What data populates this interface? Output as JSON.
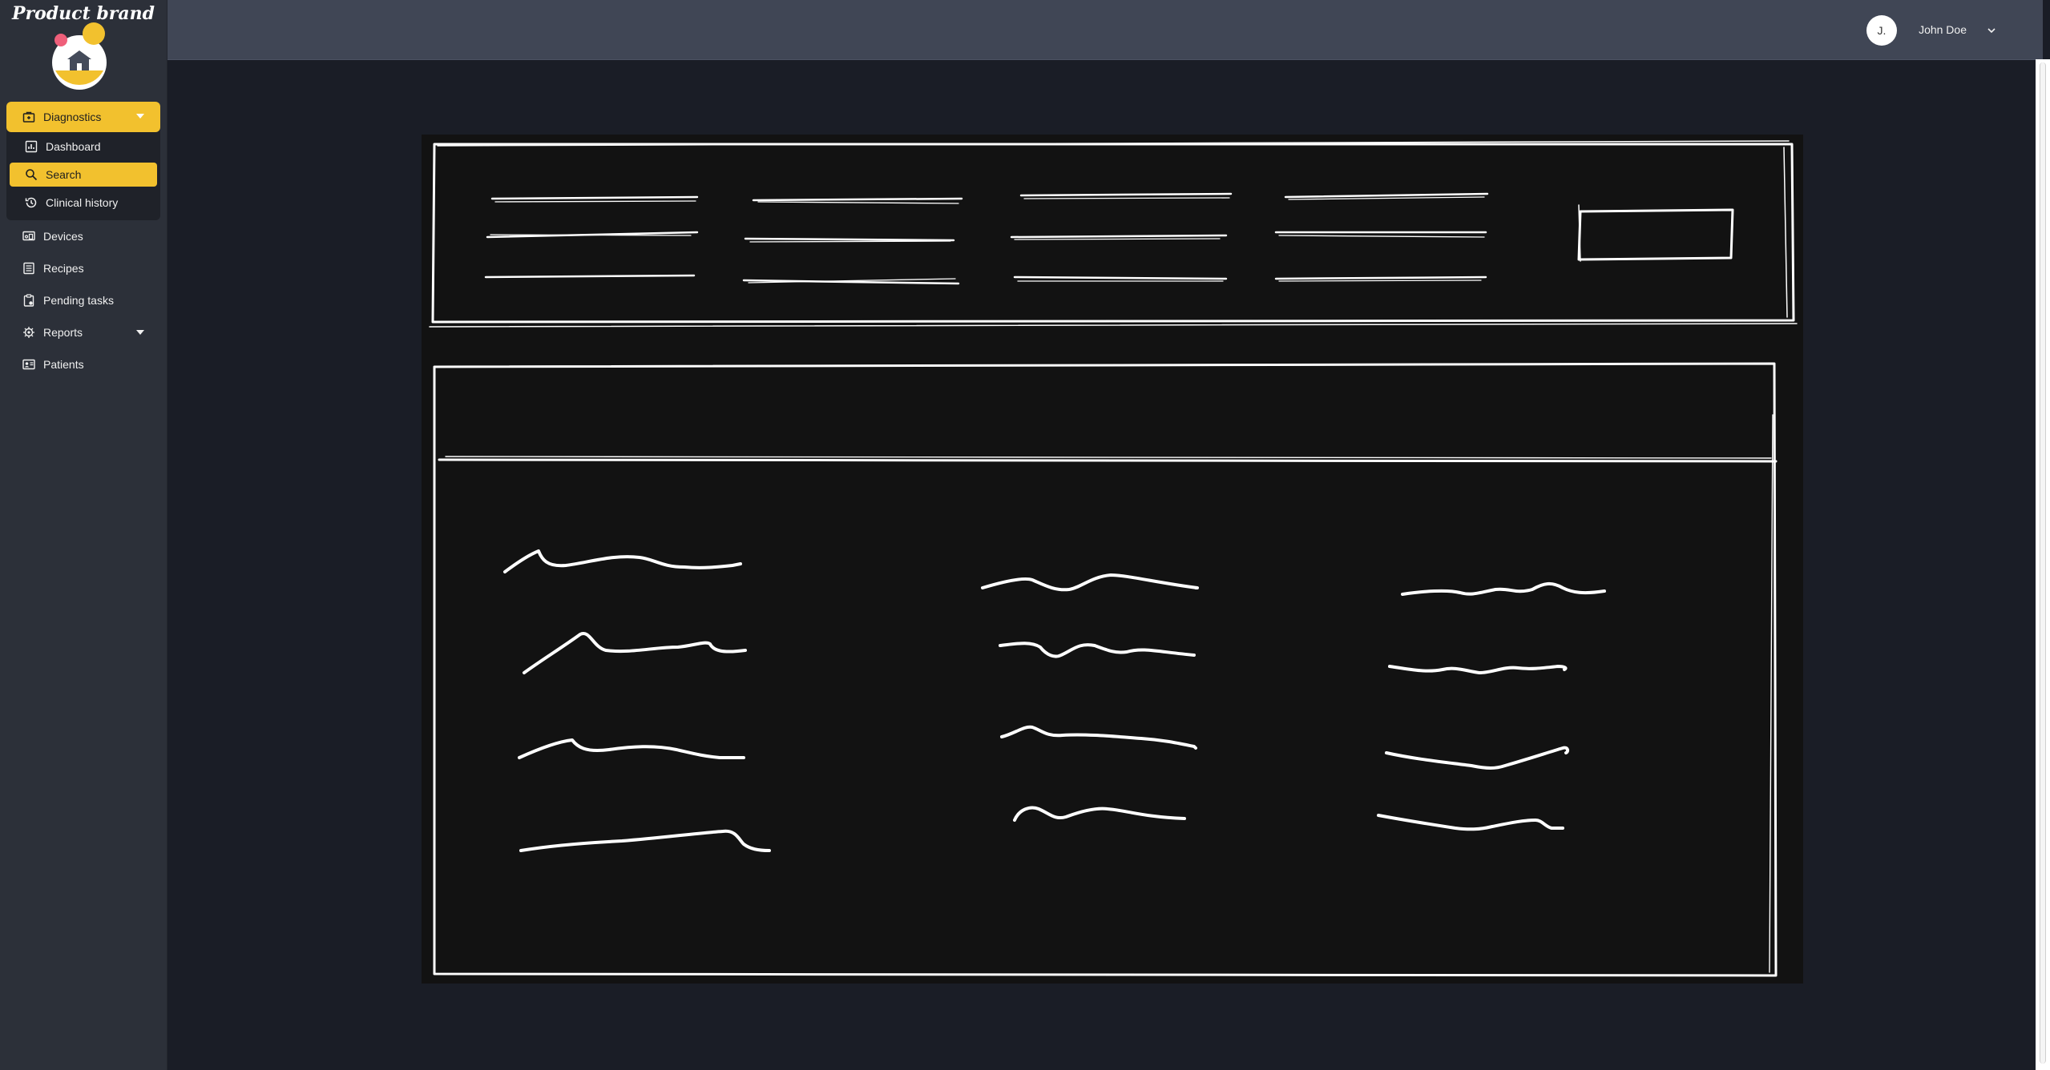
{
  "brand": {
    "name": "Product brand"
  },
  "user": {
    "initials": "J.",
    "name": "John Doe"
  },
  "colors": {
    "accent": "#f2c12e",
    "sidebar": "#2c3039",
    "topbar": "#404655",
    "content": "#1a1d26"
  },
  "sidebar": {
    "diagnostics": {
      "label": "Diagnostics",
      "icon": "briefcase-icon",
      "expanded": true,
      "children": [
        {
          "label": "Dashboard",
          "icon": "chart-icon"
        },
        {
          "label": "Search",
          "icon": "search-icon",
          "active": true
        },
        {
          "label": "Clinical history",
          "icon": "history-icon"
        }
      ]
    },
    "items": [
      {
        "label": "Devices",
        "icon": "devices-icon"
      },
      {
        "label": "Recipes",
        "icon": "list-icon"
      },
      {
        "label": "Pending tasks",
        "icon": "clipboard-icon"
      },
      {
        "label": "Reports",
        "icon": "gear-icon",
        "has_submenu": true
      },
      {
        "label": "Patients",
        "icon": "id-card-icon"
      }
    ]
  }
}
